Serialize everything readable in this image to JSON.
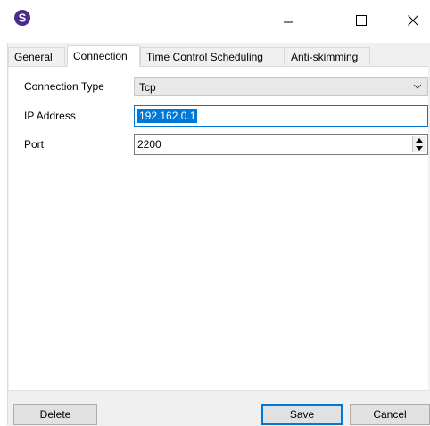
{
  "window": {
    "app_icon": "s-logo-icon",
    "controls": [
      "minimize-icon",
      "maximize-icon",
      "close-icon"
    ]
  },
  "tabs": [
    {
      "label": "General",
      "active": false
    },
    {
      "label": "Connection",
      "active": true
    },
    {
      "label": "Time Control Scheduling",
      "active": false
    },
    {
      "label": "Anti-skimming",
      "active": false
    }
  ],
  "form": {
    "connection_type": {
      "label": "Connection Type",
      "value": "Tcp"
    },
    "ip_address": {
      "label": "IP Address",
      "value": "192.162.0.1"
    },
    "port": {
      "label": "Port",
      "value": "2200"
    }
  },
  "buttons": {
    "delete": "Delete",
    "save": "Save",
    "cancel": "Cancel"
  },
  "colors": {
    "selection": "#0078d7",
    "logo": "#4a2c8c"
  }
}
